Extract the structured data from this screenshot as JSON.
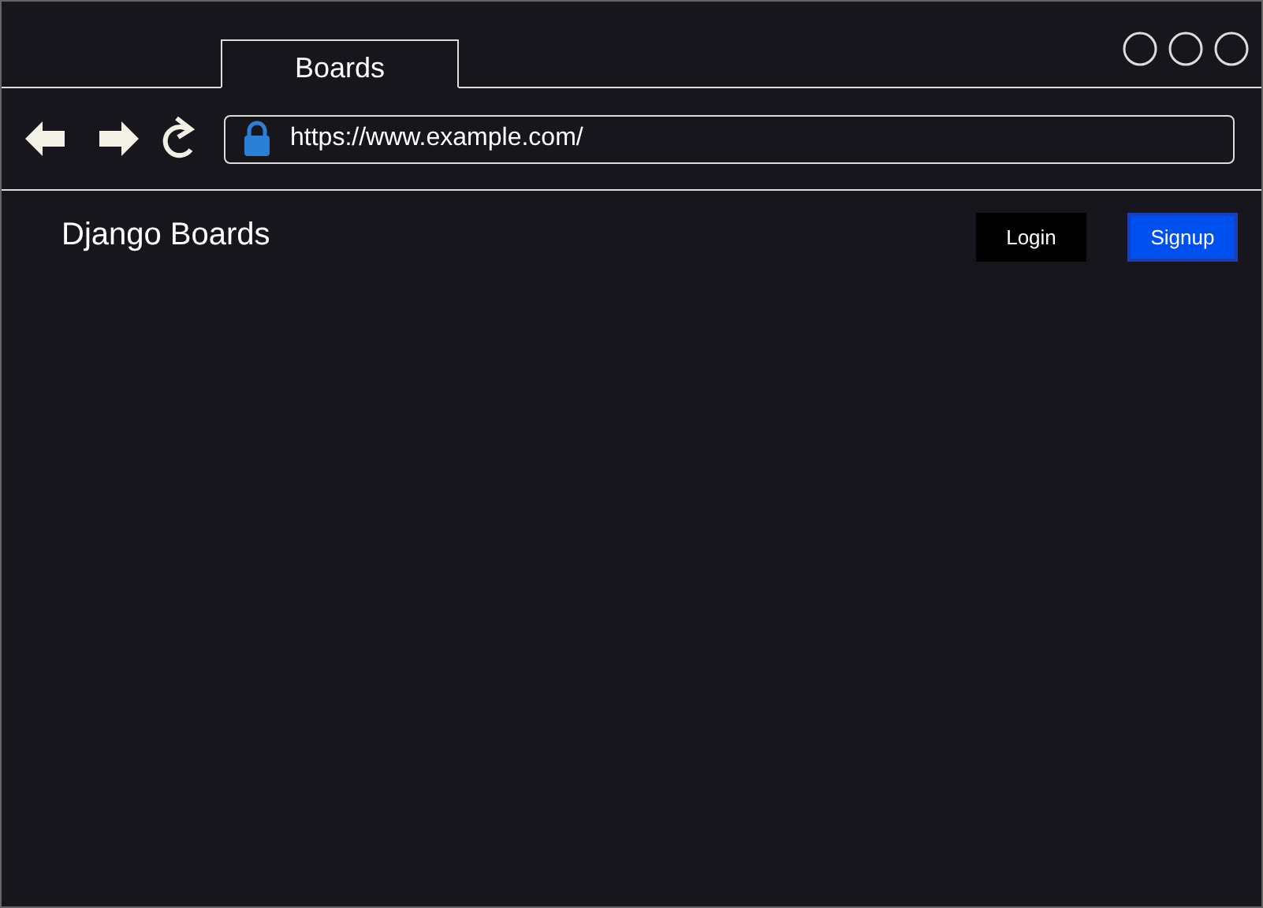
{
  "tabs": [
    {
      "label": "Boards",
      "selected": true
    }
  ],
  "address_bar": {
    "url": "https://www.example.com/",
    "secure": true
  },
  "page": {
    "brand": "Django Boards",
    "buttons": [
      {
        "label": "Login",
        "kind": "plain"
      },
      {
        "label": "Signup",
        "kind": "primary"
      }
    ]
  }
}
